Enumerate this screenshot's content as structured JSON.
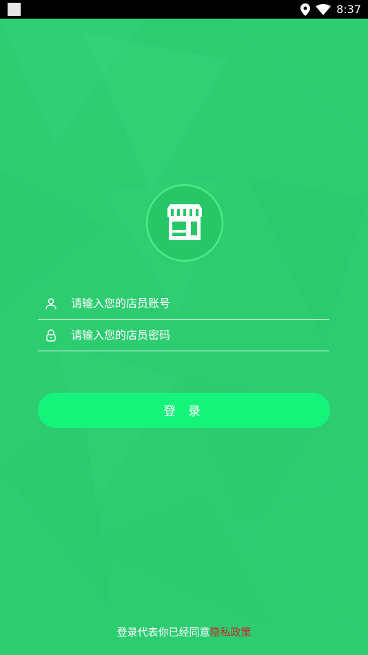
{
  "status_bar": {
    "time": "8:37",
    "icons": [
      "location-icon",
      "wifi-icon",
      "clock-time"
    ]
  },
  "login": {
    "account_placeholder": "请输入您的店员账号",
    "password_placeholder": "请输入您的店员密码",
    "button_label": "登 录"
  },
  "footer": {
    "agreement_prefix": "登录代表你已经同意",
    "privacy_link": "隐私政策"
  },
  "colors": {
    "background": "#2ecc71",
    "button": "#14f47a",
    "link": "#c62828"
  }
}
